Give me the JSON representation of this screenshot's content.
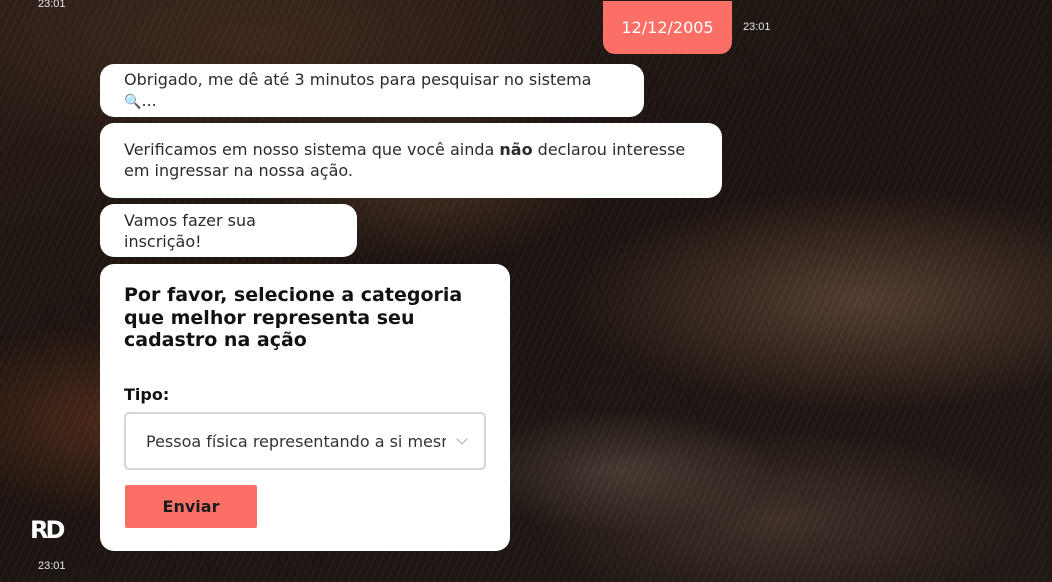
{
  "chat": {
    "top_time": "23:01",
    "user_message": {
      "text": "12/12/2005",
      "time": "23:01"
    },
    "bot_messages": [
      {
        "text": "Obrigado, me dê até 3 minutos para pesquisar no sistema ",
        "icon": "magnifier-icon",
        "suffix": "..."
      },
      {
        "text_before": "Verificamos em nosso sistema que você ainda ",
        "bold": "não",
        "text_after": " declarou interesse em ingressar na nossa ação."
      },
      {
        "text": "Vamos fazer sua inscrição!"
      }
    ],
    "bottom_time": "23:01"
  },
  "form": {
    "title": "Por favor, selecione a categoria que melhor representa seu cadastro na ação",
    "label": "Tipo:",
    "select_value": "Pessoa física representando a si mesma",
    "submit_label": "Enviar"
  },
  "brand": {
    "logo_text": "RD"
  },
  "colors": {
    "accent": "#fb6f66",
    "bubble": "#ffffff"
  }
}
